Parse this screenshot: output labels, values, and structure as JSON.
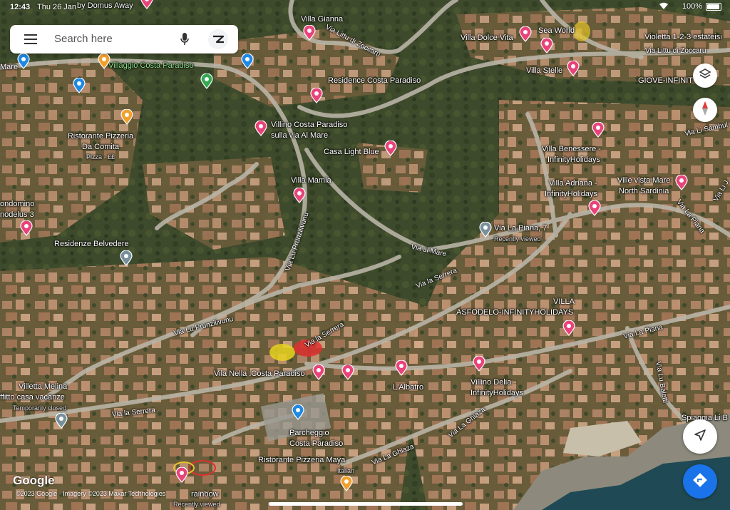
{
  "status_bar": {
    "time": "12:43",
    "date": "Thu 26 Jan",
    "battery": "100%"
  },
  "search": {
    "placeholder": "Search here"
  },
  "footer": {
    "brand": "Google",
    "attribution": "©2023 Google · Imagery ©2023 Maxar Technologies"
  },
  "colors": {
    "lodging_pin": "#e8437a",
    "food_pin": "#f2a02c",
    "blue_pin": "#1e88e5",
    "grey_pin": "#78909c",
    "park_pin": "#34a853",
    "directions": "#1a73e8"
  },
  "labels": {
    "by_domus_away": "by Domus Away",
    "villa_gianna": "Villa Gianna",
    "via_littu_1": "Via Littu di Zoccaru",
    "villa_dolce_vita": "Villa Dolce Vita",
    "sea_world": "Sea World",
    "violetta": "Violetta 1-2-3 estateisi",
    "via_littu_2": "Via Littu di Zoccaru",
    "villa_stelle": "Villa Stelle",
    "giove": "GIOVE-INFINIT",
    "mare": "Mare",
    "villaggio": "Villaggio Costa Paradiso",
    "residence_cp": "Residence Costa Paradiso",
    "ristorante_comita_1": "Ristorante Pizzeria",
    "ristorante_comita_2": "Da Comita",
    "ristorante_comita_price": "Pizza · ££",
    "villino_1": "Villino Costa Paradiso",
    "villino_2": "sulla via Al Mare",
    "casa_light_blue": "Casa Light Blue",
    "via_li_sambul": "Via Li Sambul",
    "villa_benessere_1": "Villa Benessere -",
    "villa_benessere_2": "InfinityHolidays",
    "villa_mamia": "Villa Mamia",
    "villa_adriana_1": "Villa Adriana -",
    "villa_adriana_2": "InfinityHolidays",
    "ville_vista_1": "Ville vista Mare",
    "ville_vista_2": "North Sardinia",
    "condomino_1": "ondomino",
    "condomino_2": "nodelus 3",
    "residenze_belvedere": "Residenze Belvedere",
    "via_lu_prunzilivunu_v": "Via Lu Prunzilivunu",
    "via_la_piana_7": "Via La Piana, 7",
    "recently_viewed": "Recently viewed",
    "via_al_mare": "Via al Mare",
    "via_la_piana_1": "Via La Piana",
    "via_la_piana_2": "Via La Piana",
    "via_la_serrera_1": "Via la Serrera",
    "villa_asfodelo_1": "VILLA",
    "villa_asfodelo_2": "ASFODELO-INFINITYHOLIDAYS",
    "via_lu_prunzilivunu_h": "Via Lu Prunzilivunu",
    "via_la_serrera_2": "Via la Serrera",
    "villetta_melina": "Villetta Melina",
    "affitto_1": "ffitto casa vacanze",
    "affitto_2": "Temporarily closed",
    "vila_nella": "Vila Nella .Costa Paradiso",
    "l_albatro": "L'Albatro",
    "villino_delia_1": "Villino Delia -",
    "villino_delia_2": "InfinityHolidays",
    "via_lu_baletti": "Via Lu Baletti",
    "via_la_serrera_3": "Via la Serrera",
    "via_la_ghiaza_1": "Via La Ghiaza",
    "spiaggia": "Spiaggia Li B",
    "parcheggio_1": "Parcheggio",
    "parcheggio_2": "Costa Paradiso",
    "via_la_ghiaza_2": "Via La Ghiaza",
    "ristorante_maya": "Ristorante Pizzeria Maya",
    "italian": "Italian",
    "rainbow": "rainbow",
    "recently_viewed_2": "Recently viewed",
    "via_li_j": "Via Li J"
  }
}
